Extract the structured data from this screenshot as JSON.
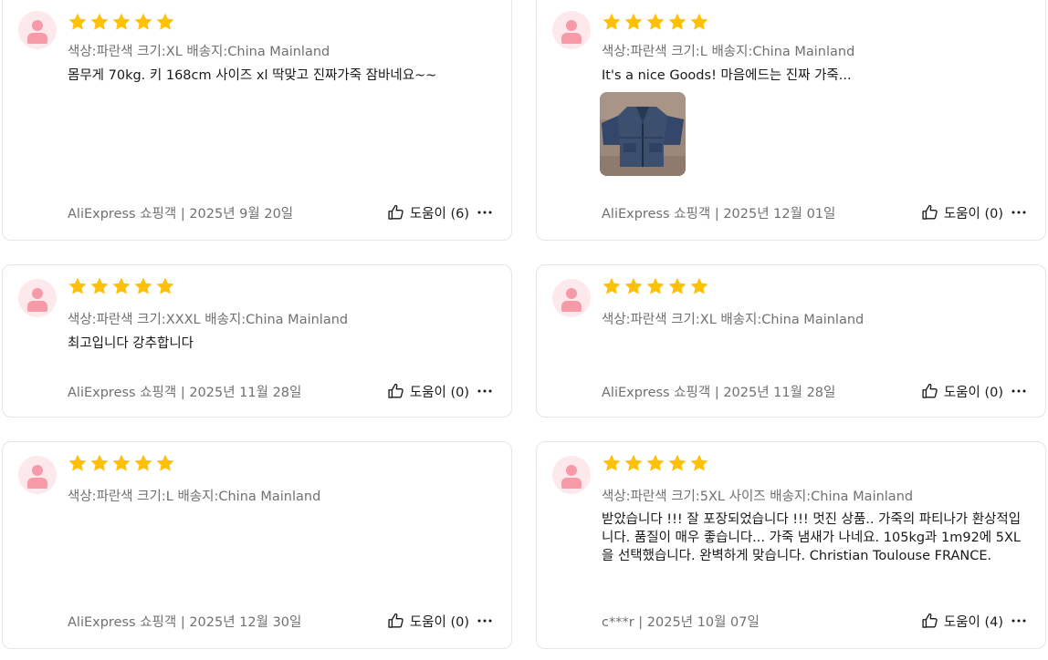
{
  "colors": {
    "star": "#ffc107",
    "avatar_bg": "#fde8ec",
    "avatar_fg": "#f69aa8",
    "meta_text": "#707070"
  },
  "reviews": [
    {
      "rating": 5,
      "meta": "색상:파란색 크기:XL 배송지:China Mainland",
      "text": "몸무게 70kg. 키 168cm 사이즈 xl 딱맞고 진짜가죽 잠바네요~~",
      "author_date": "AliExpress 쇼핑객 | 2025년 9월 20일",
      "helpful": "도움이 (6)",
      "photo_icon": "leather-jacket-photo"
    },
    {
      "rating": 5,
      "meta": "색상:파란색 크기:L 배송지:China Mainland",
      "text": "It's a nice Goods! 마음에드는 진짜 가죽...",
      "author_date": "AliExpress 쇼핑객 | 2025년 12월 01일",
      "helpful": "도움이 (0)",
      "photo_icon": "leather-jacket-photo"
    },
    {
      "rating": 5,
      "meta": "색상:파란색 크기:XXXL 배송지:China Mainland",
      "text": "최고입니다 강추합니다",
      "author_date": "AliExpress 쇼핑객 | 2025년 11월 28일",
      "helpful": "도움이 (0)"
    },
    {
      "rating": 5,
      "meta": "색상:파란색 크기:XL 배송지:China Mainland",
      "text": "",
      "author_date": "AliExpress 쇼핑객 | 2025년 11월 28일",
      "helpful": "도움이 (0)"
    },
    {
      "rating": 5,
      "meta": "색상:파란색 크기:L 배송지:China Mainland",
      "text": "",
      "author_date": "AliExpress 쇼핑객 | 2025년 12월 30일",
      "helpful": "도움이 (0)"
    },
    {
      "rating": 5,
      "meta": "색상:파란색 크기:5XL 사이즈 배송지:China Mainland",
      "text": "받았습니다 !!! 잘 포장되었습니다 !!! 멋진 상품.. 가죽의 파티나가 환상적입니다. 품질이 매우 좋습니다... 가죽 냄새가 나네요. 105kg과 1m92에 5XL을 선택했습니다. 완벽하게 맞습니다. Christian Toulouse FRANCE.",
      "author_date": "c***r | 2025년 10월 07일",
      "helpful": "도움이 (4)"
    }
  ]
}
